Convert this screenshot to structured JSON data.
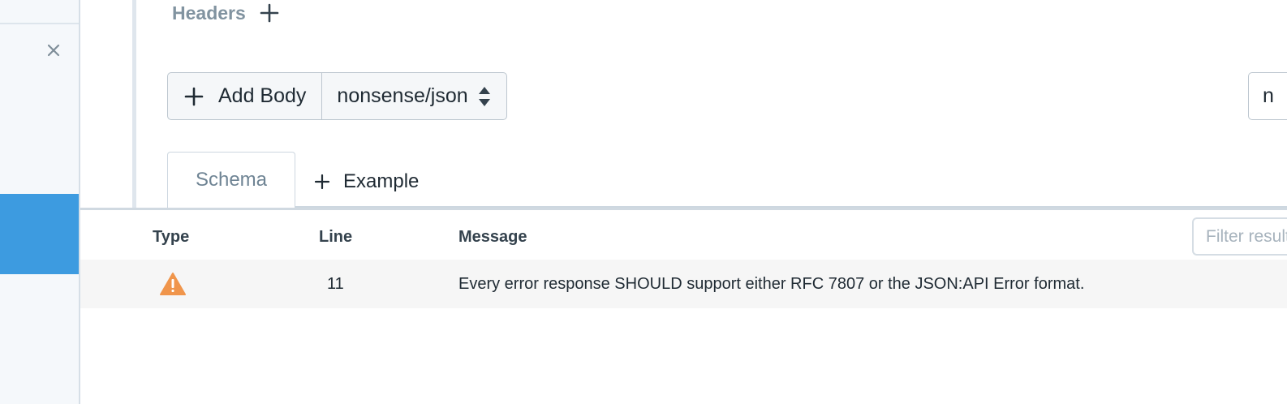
{
  "editor": {
    "headers_label": "Headers",
    "add_body_label": "Add Body",
    "media_type": "nonsense/json",
    "right_input_value": "n",
    "tabs": [
      {
        "label": "Schema",
        "active": true
      },
      {
        "label": "Example",
        "active": false
      }
    ]
  },
  "problems": {
    "columns": {
      "type": "Type",
      "line": "Line",
      "message": "Message"
    },
    "filter_placeholder": "Filter results",
    "rows": [
      {
        "type": "warning",
        "type_icon": "warning-triangle-icon",
        "line": "11",
        "message": "Every error response SHOULD support either RFC 7807 or the JSON:API Error format."
      }
    ]
  },
  "colors": {
    "accent": "#3d9be0",
    "warning": "#f0954b"
  }
}
